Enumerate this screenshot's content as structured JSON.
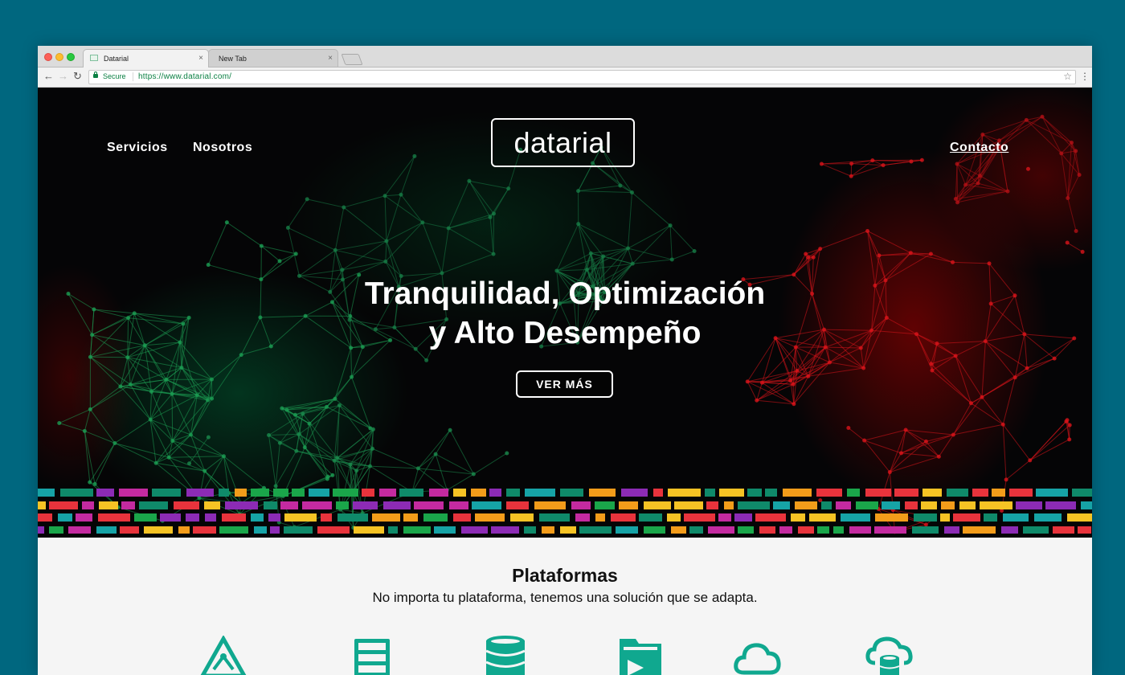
{
  "browser": {
    "tabs": [
      {
        "title": "Datarial",
        "close": "×"
      },
      {
        "title": "New Tab",
        "close": "×"
      }
    ],
    "secure_label": "Secure",
    "url": "https://www.datarial.com/",
    "nav": {
      "back": "←",
      "forward": "→",
      "reload": "↻",
      "star": "☆",
      "menu": "⋮"
    }
  },
  "site": {
    "nav_left": [
      "Servicios",
      "Nosotros"
    ],
    "logo": "datarial",
    "nav_right": "Contacto",
    "hero": {
      "title_line1": "Tranquilidad, Optimización",
      "title_line2": "y Alto Desempeño",
      "cta": "VER MÁS"
    },
    "platforms": {
      "title": "Plataformas",
      "subtitle": "No importa tu plataforma, tenemos una solución que se adapta.",
      "icons": [
        "triangle-network-icon",
        "server-rack-icon",
        "database-icon",
        "folder-play-icon",
        "cloud-icon",
        "cloud-database-icon"
      ]
    }
  },
  "colors": {
    "page_bg": "#00677f",
    "icon_teal": "#10a88f",
    "strip": [
      "#e8333c",
      "#1aa64a",
      "#16a3a6",
      "#f39c1a",
      "#c42aa0",
      "#8c2bb5",
      "#0f8a6a",
      "#f6c324"
    ]
  }
}
